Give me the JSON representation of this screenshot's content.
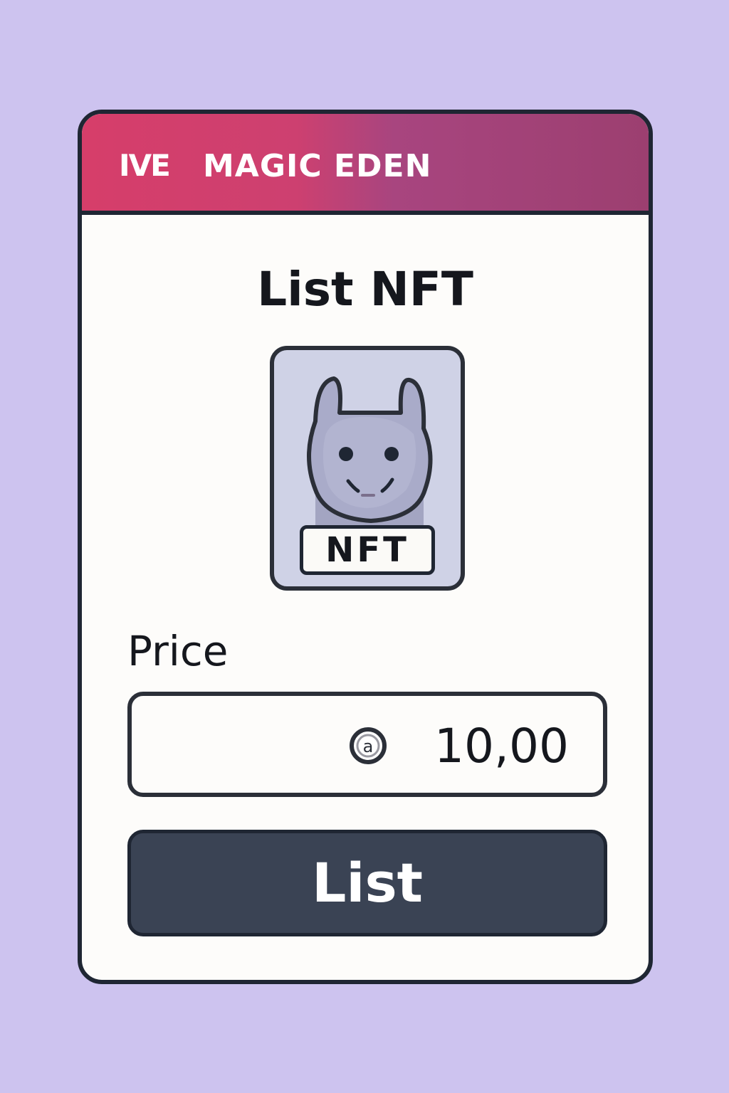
{
  "header": {
    "logo_mark": "IVE",
    "brand_name": "MAGIC EDEN"
  },
  "dialog": {
    "title": "List NFT"
  },
  "nft": {
    "tag_label": "NFT"
  },
  "price": {
    "label": "Price",
    "currency_icon": "currency-icon",
    "value": "10,00"
  },
  "actions": {
    "list_label": "List"
  },
  "colors": {
    "background": "#cdc3ef",
    "header_start": "#d63e6a",
    "header_end": "#9c3f70",
    "card": "#fdfcfa",
    "button": "#3a4354",
    "outline": "#1f2633"
  }
}
